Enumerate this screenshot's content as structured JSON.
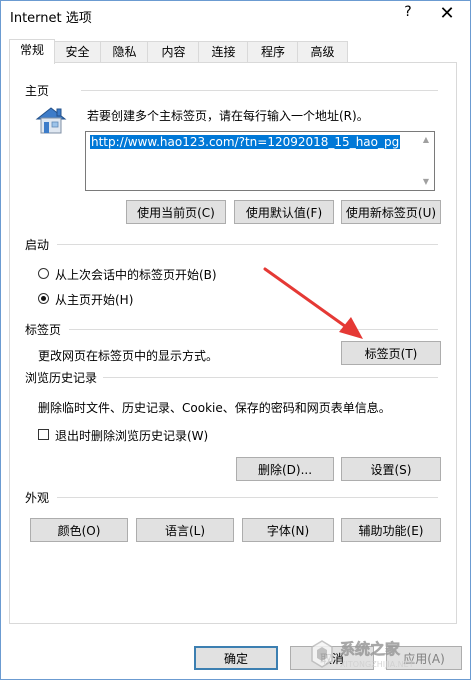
{
  "window": {
    "title": "Internet 选项",
    "help_glyph": "?",
    "close_glyph": "✕"
  },
  "tabs": [
    {
      "label": "常规",
      "active": true
    },
    {
      "label": "安全",
      "active": false
    },
    {
      "label": "隐私",
      "active": false
    },
    {
      "label": "内容",
      "active": false
    },
    {
      "label": "连接",
      "active": false
    },
    {
      "label": "程序",
      "active": false
    },
    {
      "label": "高级",
      "active": false
    }
  ],
  "homepage": {
    "heading": "主页",
    "description": "若要创建多个主标签页，请在每行输入一个地址(R)。",
    "url": "http://www.hao123.com/?tn=12092018_15_hao_pg",
    "buttons": {
      "use_current": "使用当前页(C)",
      "use_default": "使用默认值(F)",
      "use_new_tab": "使用新标签页(U)"
    }
  },
  "startup": {
    "heading": "启动",
    "option_last_session": "从上次会话中的标签页开始(B)",
    "option_homepage": "从主页开始(H)",
    "selected": "homepage"
  },
  "tabs_section": {
    "heading": "标签页",
    "description": "更改网页在标签页中的显示方式。",
    "button": "标签页(T)"
  },
  "history": {
    "heading": "浏览历史记录",
    "description": "删除临时文件、历史记录、Cookie、保存的密码和网页表单信息。",
    "checkbox_label": "退出时删除浏览历史记录(W)",
    "checkbox_checked": false,
    "delete_button": "删除(D)...",
    "settings_button": "设置(S)"
  },
  "appearance": {
    "heading": "外观",
    "colors_button": "颜色(O)",
    "languages_button": "语言(L)",
    "fonts_button": "字体(N)",
    "accessibility_button": "辅助功能(E)"
  },
  "footer": {
    "ok_button": "确定",
    "cancel_button": "取消",
    "apply_button": "应用(A)"
  },
  "watermark": {
    "brand_cn": "系统之家",
    "brand_en": "XITONGZHIJIA.NET"
  },
  "colors": {
    "accent_blue": "#0078d7",
    "arrow_red": "#e53935",
    "default_border": "#3c7fb1"
  }
}
